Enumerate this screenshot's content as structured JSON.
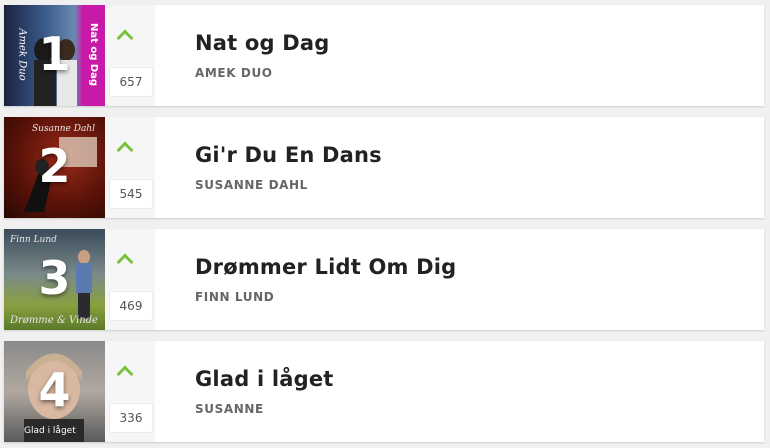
{
  "entries": [
    {
      "rank": "1",
      "title": "Nat og Dag",
      "artist": "AMEK DUO",
      "votes": "657",
      "cover_text": "Nat og Dag",
      "cover_side_text": "Amek Duo",
      "cover_colors": [
        "#1c2a4a",
        "#c81aa8"
      ]
    },
    {
      "rank": "2",
      "title": "Gi'r Du En Dans",
      "artist": "SUSANNE DAHL",
      "votes": "545",
      "cover_text": "Susanne Dahl",
      "cover_colors": [
        "#3a1208",
        "#8a1a10"
      ]
    },
    {
      "rank": "3",
      "title": "Drømmer Lidt Om Dig",
      "artist": "FINN LUND",
      "votes": "469",
      "cover_text": "Finn Lund",
      "cover_bottom_text": "Drømme & Vinde",
      "cover_colors": [
        "#4a5a5a",
        "#6e8a3a"
      ]
    },
    {
      "rank": "4",
      "title": "Glad i låget",
      "artist": "SUSANNE",
      "votes": "336",
      "cover_bottom_text": "Glad i låget",
      "cover_colors": [
        "#6a6a6a",
        "#c8a890"
      ]
    }
  ]
}
